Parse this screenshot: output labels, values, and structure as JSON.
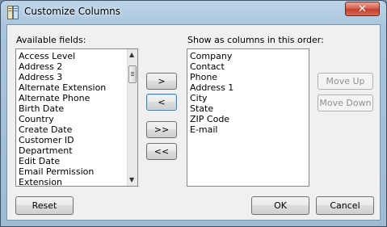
{
  "window": {
    "title": "Customize Columns",
    "close_label": "✕"
  },
  "available": {
    "label": "Available fields:",
    "items": [
      "Access Level",
      "Address 2",
      "Address 3",
      "Alternate Extension",
      "Alternate Phone",
      "Birth Date",
      "Country",
      "Create Date",
      "Customer ID",
      "Department",
      "Edit Date",
      "Email Permission",
      "Extension"
    ]
  },
  "selected": {
    "label": "Show as columns in this order:",
    "items": [
      "Company",
      "Contact",
      "Phone",
      "Address 1",
      "City",
      "State",
      "ZIP Code",
      "E-mail"
    ]
  },
  "transfer": {
    "add_one": ">",
    "remove_one": "<",
    "add_all": ">>",
    "remove_all": "<<"
  },
  "order": {
    "move_up": "Move Up",
    "move_down": "Move Down"
  },
  "footer": {
    "reset": "Reset",
    "ok": "OK",
    "cancel": "Cancel"
  }
}
